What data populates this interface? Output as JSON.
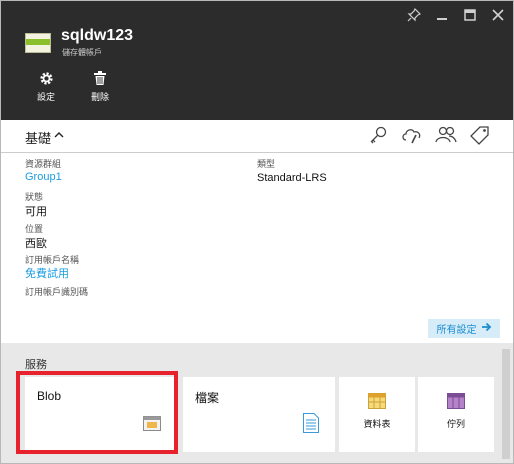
{
  "header": {
    "title": "sqldw123",
    "subtitle": "儲存體帳戶",
    "commands": {
      "settings": "設定",
      "delete": "刪除"
    }
  },
  "essentials": {
    "title": "基礎",
    "left": [
      {
        "label": "資源群組",
        "value": "Group1"
      },
      {
        "label": "狀態",
        "value": "可用"
      },
      {
        "label": "位置",
        "value": "西歐"
      },
      {
        "label": "訂用帳戶名稱",
        "value": "免費試用"
      },
      {
        "label": "訂用帳戶識別碼",
        "value": ""
      }
    ],
    "right": [
      {
        "label": "類型",
        "value": "Standard-LRS"
      }
    ],
    "all_settings": "所有設定"
  },
  "services": {
    "heading": "服務",
    "tiles": [
      {
        "name": "Blob",
        "icon": "blob-icon"
      },
      {
        "name": "檔案",
        "icon": "file-icon"
      },
      {
        "name": "資料表",
        "icon": "table-icon"
      },
      {
        "name": "佇列",
        "icon": "queue-icon"
      }
    ]
  },
  "colors": {
    "header_bg": "#2c2c2c",
    "link": "#1c9ce0",
    "highlight": "#e8222d",
    "services_bg": "#e8e8e8"
  }
}
